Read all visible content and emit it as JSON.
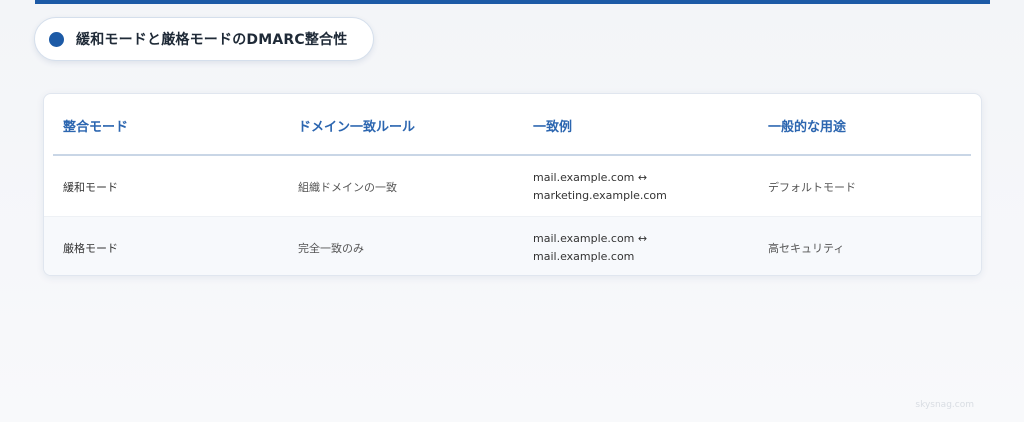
{
  "title": "緩和モードと厳格モードのDMARC整合性",
  "table": {
    "headers": [
      "整合モード",
      "ドメイン一致ルール",
      "一致例",
      "一般的な用途"
    ],
    "rows": [
      {
        "mode": "緩和モード",
        "rule": "組織ドメインの一致",
        "example_line1": "mail.example.com ↔",
        "example_line2": "marketing.example.com",
        "use": "デフォルトモード"
      },
      {
        "mode": "厳格モード",
        "rule": "完全一致のみ",
        "example_line1": "mail.example.com ↔",
        "example_line2": "mail.example.com",
        "use": "高セキュリティ"
      }
    ]
  },
  "watermark": "skysnag.com",
  "colors": {
    "accent": "#1c5aa6",
    "header_text": "#2c66b0"
  }
}
